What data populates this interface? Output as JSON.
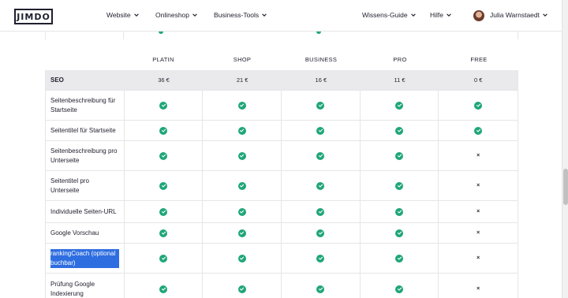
{
  "header": {
    "logo": "JIMDO",
    "nav_left": [
      "Website",
      "Onlineshop",
      "Business-Tools"
    ],
    "nav_right": [
      "Wissens-Guide",
      "Hilfe"
    ],
    "user_name": "Julia Warnstaedt"
  },
  "plans": [
    "PLATIN",
    "SHOP",
    "BUSINESS",
    "PRO",
    "FREE"
  ],
  "section": {
    "title": "SEO",
    "prices": [
      "36 €",
      "21 €",
      "16 €",
      "11 €",
      "0 €"
    ]
  },
  "features": [
    {
      "label": "Seitenbeschreibung für Startseite",
      "values": [
        "check",
        "check",
        "check",
        "check",
        "check"
      ]
    },
    {
      "label": "Seitentitel für Startseite",
      "values": [
        "check",
        "check",
        "check",
        "check",
        "check"
      ]
    },
    {
      "label": "Seitenbeschreibung pro Unterseite",
      "values": [
        "check",
        "check",
        "check",
        "check",
        "cross"
      ]
    },
    {
      "label": "Seitentitel pro Unterseite",
      "values": [
        "check",
        "check",
        "check",
        "check",
        "cross"
      ]
    },
    {
      "label": "Individuelle Seiten-URL",
      "values": [
        "check",
        "check",
        "check",
        "check",
        "cross"
      ]
    },
    {
      "label": "Google Vorschau",
      "values": [
        "check",
        "check",
        "check",
        "check",
        "cross"
      ]
    },
    {
      "label": "rankingCoach (optional buchbar)",
      "values": [
        "check",
        "check",
        "check",
        "check",
        "cross"
      ],
      "selected": true
    },
    {
      "label": "Prüfung Google Indexierung",
      "values": [
        "check",
        "check",
        "check",
        "check",
        "cross"
      ]
    }
  ],
  "cross_symbol": "×",
  "colors": {
    "check": "#1fa67a",
    "section_bg": "#eaeaec",
    "selection": "#2f6ee0"
  }
}
